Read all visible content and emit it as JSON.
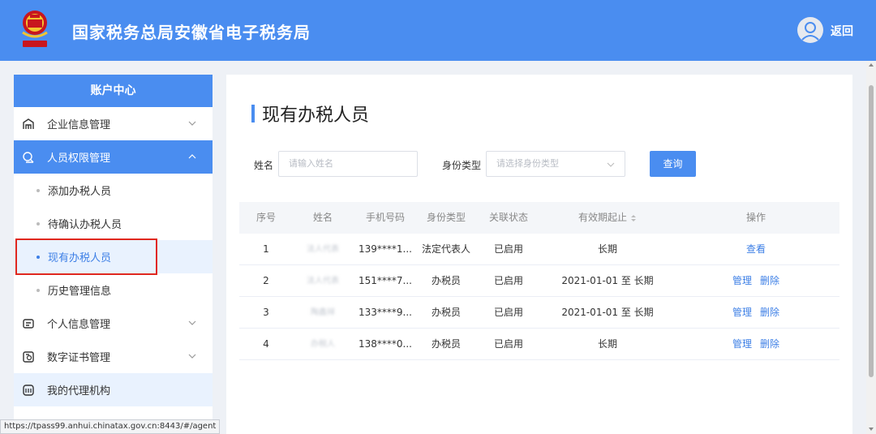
{
  "header": {
    "title": "国家税务总局安徽省电子税务局",
    "back_label": "返回",
    "emblem_color": "#c8161e"
  },
  "sidebar": {
    "title": "账户中心",
    "items": [
      {
        "label": "企业信息管理",
        "icon": "building-icon",
        "state": "collapsed"
      },
      {
        "label": "人员权限管理",
        "icon": "user-lock-icon",
        "state": "expanded"
      },
      {
        "label": "个人信息管理",
        "icon": "id-card-icon",
        "state": "collapsed"
      },
      {
        "label": "数字证书管理",
        "icon": "certificate-icon",
        "state": "collapsed"
      },
      {
        "label": "我的代理机构",
        "icon": "agency-icon",
        "state": "none"
      }
    ],
    "sub_items": [
      {
        "label": "添加办税人员"
      },
      {
        "label": "待确认办税人员"
      },
      {
        "label": "现有办税人员",
        "current": true
      },
      {
        "label": "历史管理信息"
      }
    ]
  },
  "status_url": "https://tpass99.anhui.chinatax.gov.cn:8443/#/agent",
  "main": {
    "page_title": "现有办税人员",
    "search": {
      "name_label": "姓名",
      "name_placeholder": "请输入姓名",
      "identity_label": "身份类型",
      "identity_placeholder": "请选择身份类型",
      "query_button": "查询"
    },
    "table": {
      "headers": [
        "序号",
        "姓名",
        "手机号码",
        "身份类型",
        "关联状态",
        "有效期起止",
        "操作"
      ],
      "rows": [
        {
          "index": "1",
          "name": "法人代表",
          "phone": "139****1...",
          "identity": "法定代表人",
          "status": "已启用",
          "validity": "长期",
          "actions": [
            "查看"
          ]
        },
        {
          "index": "2",
          "name": "法人代表",
          "phone": "151****7...",
          "identity": "办税员",
          "status": "已启用",
          "validity": "2021-01-01 至 长期",
          "actions": [
            "管理",
            "删除"
          ]
        },
        {
          "index": "3",
          "name": "陶鑫祥",
          "phone": "133****9...",
          "identity": "办税员",
          "status": "已启用",
          "validity": "2021-01-01 至 长期",
          "actions": [
            "管理",
            "删除"
          ]
        },
        {
          "index": "4",
          "name": "办税人",
          "phone": "138****0...",
          "identity": "办税员",
          "status": "已启用",
          "validity": "长期",
          "actions": [
            "管理",
            "删除"
          ]
        }
      ]
    }
  },
  "colors": {
    "primary": "#4a8df0",
    "link": "#3d7fe6",
    "highlight": "#e0281f"
  }
}
